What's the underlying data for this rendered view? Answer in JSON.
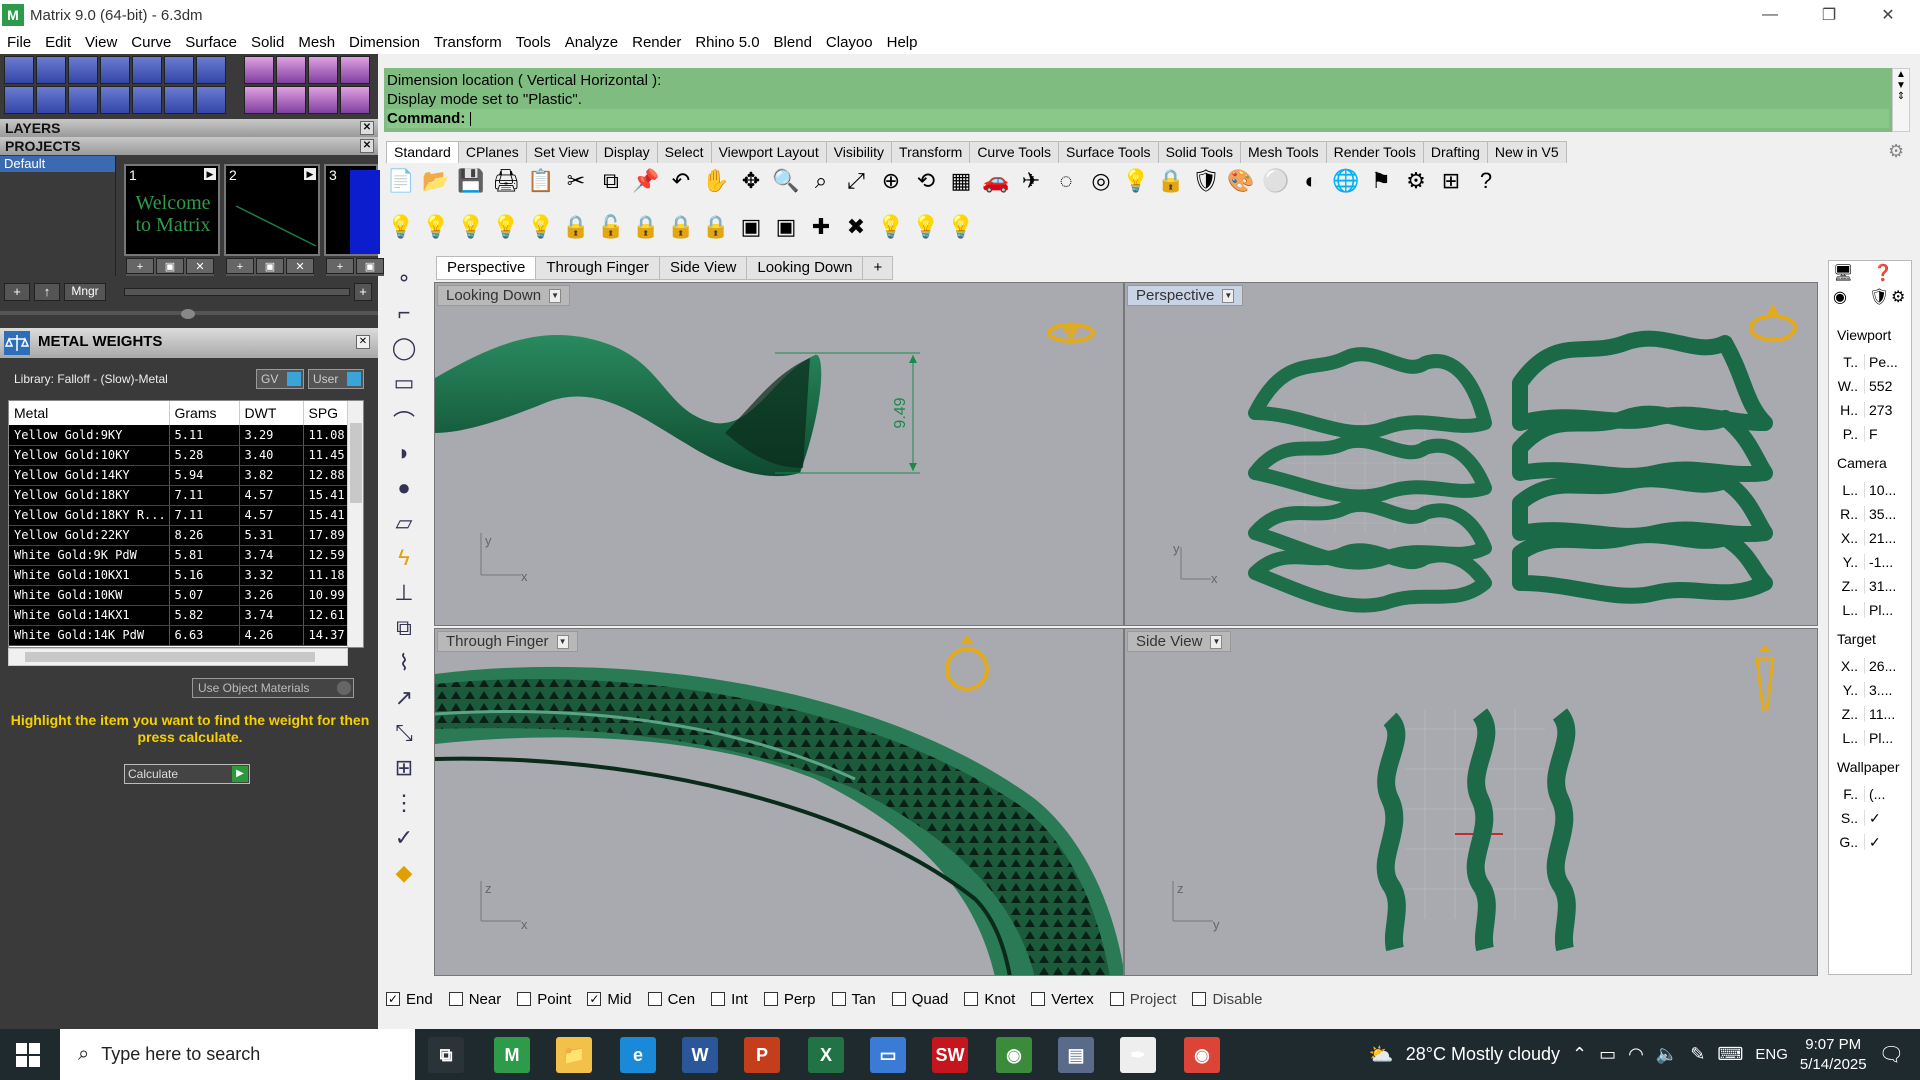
{
  "window": {
    "title": "Matrix 9.0 (64-bit) - 6.3dm",
    "app_glyph": "M"
  },
  "menu": [
    "File",
    "Edit",
    "View",
    "Curve",
    "Surface",
    "Solid",
    "Mesh",
    "Dimension",
    "Transform",
    "Tools",
    "Analyze",
    "Render",
    "Rhino 5.0",
    "Blend",
    "Clayoo",
    "Help"
  ],
  "left": {
    "layers_label": "LAYERS",
    "projects_label": "PROJECTS",
    "project_item": "Default",
    "thumbs": [
      {
        "num": "1",
        "caption": "Welcome to Matrix"
      },
      {
        "num": "2",
        "caption": ""
      },
      {
        "num": "3",
        "caption": ""
      }
    ],
    "mngr": "Mngr",
    "metal_weights_title": "METAL WEIGHTS",
    "library": "Library: Falloff - (Slow)-Metal",
    "gv": "GV",
    "user": "User",
    "columns": [
      "Metal",
      "Grams",
      "DWT",
      "SPG"
    ],
    "rows": [
      [
        "Yellow Gold:9KY",
        "5.11",
        "3.29",
        "11.08"
      ],
      [
        "Yellow Gold:10KY",
        "5.28",
        "3.40",
        "11.45"
      ],
      [
        "Yellow Gold:14KY",
        "5.94",
        "3.82",
        "12.88"
      ],
      [
        "Yellow Gold:18KY",
        "7.11",
        "4.57",
        "15.41"
      ],
      [
        "Yellow Gold:18KY R...",
        "7.11",
        "4.57",
        "15.41"
      ],
      [
        "Yellow Gold:22KY",
        "8.26",
        "5.31",
        "17.89"
      ],
      [
        "White Gold:9K PdW",
        "5.81",
        "3.74",
        "12.59"
      ],
      [
        "White Gold:10KX1",
        "5.16",
        "3.32",
        "11.18"
      ],
      [
        "White Gold:10KW",
        "5.07",
        "3.26",
        "10.99"
      ],
      [
        "White Gold:14KX1",
        "5.82",
        "3.74",
        "12.61"
      ],
      [
        "White Gold:14K PdW",
        "6.63",
        "4.26",
        "14.37"
      ]
    ],
    "use_object_materials": "Use Object Materials",
    "hint": "Highlight the item you want to find the weight for then press calculate.",
    "calculate": "Calculate"
  },
  "command": {
    "line1": "Dimension location ( Vertical  Horizontal ):",
    "line2": "Display mode set to \"Plastic\".",
    "prompt": "Command:"
  },
  "toolbar_tabs": [
    "Standard",
    "CPlanes",
    "Set View",
    "Display",
    "Select",
    "Viewport Layout",
    "Visibility",
    "Transform",
    "Curve Tools",
    "Surface Tools",
    "Solid Tools",
    "Mesh Tools",
    "Render Tools",
    "Drafting",
    "New in V5"
  ],
  "toolbar_row1": [
    "📄",
    "📂",
    "💾",
    "🖨",
    "📋",
    "✂",
    "⧉",
    "📌",
    "↶",
    "✋",
    "✥",
    "🔍",
    "⌕",
    "⤢",
    "⊕",
    "⟲",
    "▦",
    "🚗",
    "✈",
    "◌",
    "◎",
    "💡",
    "🔒",
    "🛡",
    "🎨",
    "⚪",
    "◐",
    "🌐",
    "⚑",
    "⚙",
    "⊞",
    "?"
  ],
  "toolbar_row2": [
    "💡",
    "💡",
    "💡",
    "💡",
    "💡",
    "🔒",
    "🔓",
    "🔒",
    "🔒",
    "🔒",
    "▣",
    "▣",
    "✚",
    "✖",
    "💡",
    "💡",
    "💡"
  ],
  "viewport_tabs": [
    "Perspective",
    "Through Finger",
    "Side View",
    "Looking Down",
    "+"
  ],
  "viewports": {
    "top_left": {
      "label": "Looking Down",
      "dimension": "9.49",
      "ax1": "y",
      "ax2": "x"
    },
    "top_right": {
      "label": "Perspective",
      "ax1": "y",
      "ax2": "x"
    },
    "bottom_left": {
      "label": "Through Finger",
      "ax1": "z",
      "ax2": "x"
    },
    "bottom_right": {
      "label": "Side View",
      "ax1": "z",
      "ax2": "y"
    }
  },
  "properties": {
    "viewport": "Viewport",
    "vp_rows": [
      [
        "T..",
        "Pe..."
      ],
      [
        "W..",
        "552"
      ],
      [
        "H..",
        "273"
      ],
      [
        "P..",
        "F"
      ]
    ],
    "camera": "Camera",
    "cam_rows": [
      [
        "L..",
        "10..."
      ],
      [
        "R..",
        "35..."
      ],
      [
        "X..",
        "21..."
      ],
      [
        "Y..",
        "-1..."
      ],
      [
        "Z..",
        "31..."
      ],
      [
        "L..",
        "Pl..."
      ]
    ],
    "target": "Target",
    "tgt_rows": [
      [
        "X..",
        "26..."
      ],
      [
        "Y..",
        "3...."
      ],
      [
        "Z..",
        "11..."
      ],
      [
        "L..",
        "Pl..."
      ]
    ],
    "wallpaper": "Wallpaper",
    "wp_rows": [
      [
        "F..",
        "(..."
      ],
      [
        "S..",
        "✓"
      ],
      [
        "G..",
        "✓"
      ]
    ]
  },
  "osnaps": [
    {
      "label": "End",
      "checked": true
    },
    {
      "label": "Near",
      "checked": false
    },
    {
      "label": "Point",
      "checked": false
    },
    {
      "label": "Mid",
      "checked": true
    },
    {
      "label": "Cen",
      "checked": false
    },
    {
      "label": "Int",
      "checked": false
    },
    {
      "label": "Perp",
      "checked": false
    },
    {
      "label": "Tan",
      "checked": false
    },
    {
      "label": "Quad",
      "checked": false
    },
    {
      "label": "Knot",
      "checked": false
    },
    {
      "label": "Vertex",
      "checked": false
    },
    {
      "label": "Project",
      "checked": false
    },
    {
      "label": "Disable",
      "checked": false
    }
  ],
  "taskbar": {
    "search_placeholder": "Type here to search",
    "weather": "28°C  Mostly cloudy",
    "lang": "ENG",
    "time": "9:07 PM",
    "date": "5/14/2025",
    "apps": [
      {
        "name": "task-view",
        "glyph": "⧉",
        "color": "#2a3438"
      },
      {
        "name": "matrix",
        "glyph": "M",
        "color": "#2d9b4a"
      },
      {
        "name": "file-explorer",
        "glyph": "📁",
        "color": "#f2c14a"
      },
      {
        "name": "edge",
        "glyph": "e",
        "color": "#1a8ad8"
      },
      {
        "name": "word",
        "glyph": "W",
        "color": "#2b579a"
      },
      {
        "name": "powerpoint",
        "glyph": "P",
        "color": "#c43e1c"
      },
      {
        "name": "excel",
        "glyph": "X",
        "color": "#217346"
      },
      {
        "name": "app-blue",
        "glyph": "▭",
        "color": "#3a7bd5"
      },
      {
        "name": "solidworks",
        "glyph": "SW",
        "color": "#c4161c"
      },
      {
        "name": "chrome",
        "glyph": "◉",
        "color": "#3c8a3c"
      },
      {
        "name": "app-network",
        "glyph": "▤",
        "color": "#5a6a8a"
      },
      {
        "name": "app-inkscape",
        "glyph": "✒",
        "color": "#eee"
      },
      {
        "name": "chrome2",
        "glyph": "◉",
        "color": "#db4437"
      }
    ]
  }
}
